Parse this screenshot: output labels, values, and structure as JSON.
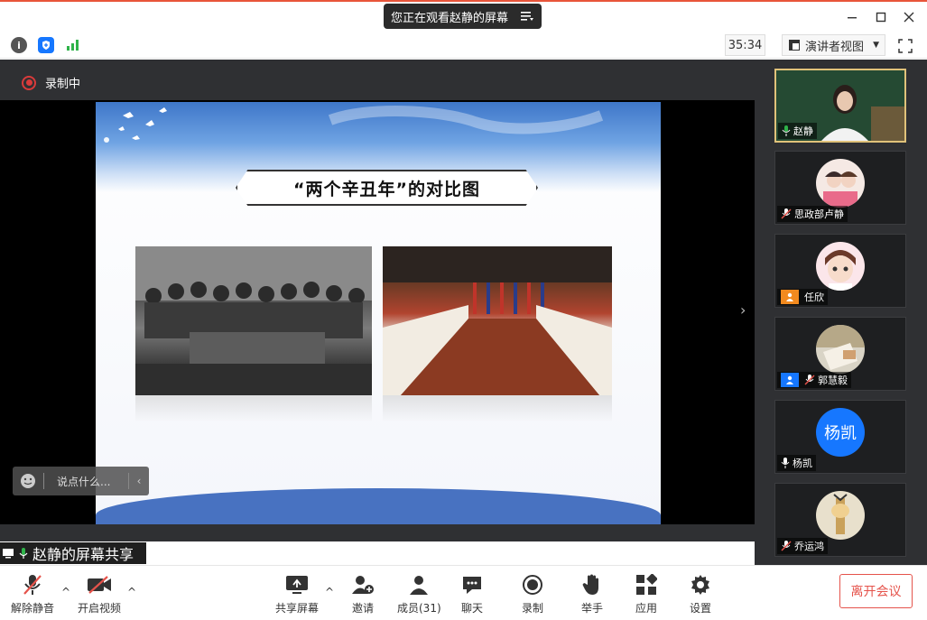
{
  "titlebar": {
    "viewing_text": "您正在观看赵静的屏幕",
    "menu_icon": "list-menu-icon"
  },
  "subbar": {
    "timer": "35:34",
    "view_mode": "演讲者视图"
  },
  "stage": {
    "recording_label": "录制中",
    "say_placeholder": "说点什么...",
    "share_label": "赵静的屏幕共享"
  },
  "slide": {
    "title": "“两个辛丑年”的对比图"
  },
  "participants": [
    {
      "name": "赵静",
      "kind": "video",
      "mic": "on",
      "active": true
    },
    {
      "name": "思政部卢静",
      "kind": "avatar",
      "mic": "off"
    },
    {
      "name": "任欣",
      "kind": "avatar",
      "mic": "none",
      "badge": "user-orange"
    },
    {
      "name": "郭慧毅",
      "kind": "avatar",
      "mic": "off",
      "badge": "user-blue"
    },
    {
      "name": "杨凯",
      "kind": "initials",
      "initials": "杨凯",
      "mic": "on",
      "color": "#1677ff"
    },
    {
      "name": "乔运鸿",
      "kind": "avatar",
      "mic": "off"
    }
  ],
  "toolbar": {
    "unmute": "解除静音",
    "start_video": "开启视频",
    "share_screen": "共享屏幕",
    "invite": "邀请",
    "members": "成员(31)",
    "chat": "聊天",
    "record": "录制",
    "raise_hand": "举手",
    "apps": "应用",
    "settings": "设置",
    "leave": "离开会议"
  },
  "colors": {
    "accent_red": "#e5534b",
    "panel_bg": "#2f3033",
    "active_tile_border": "#e0c27a",
    "initials_blue": "#1677ff"
  }
}
